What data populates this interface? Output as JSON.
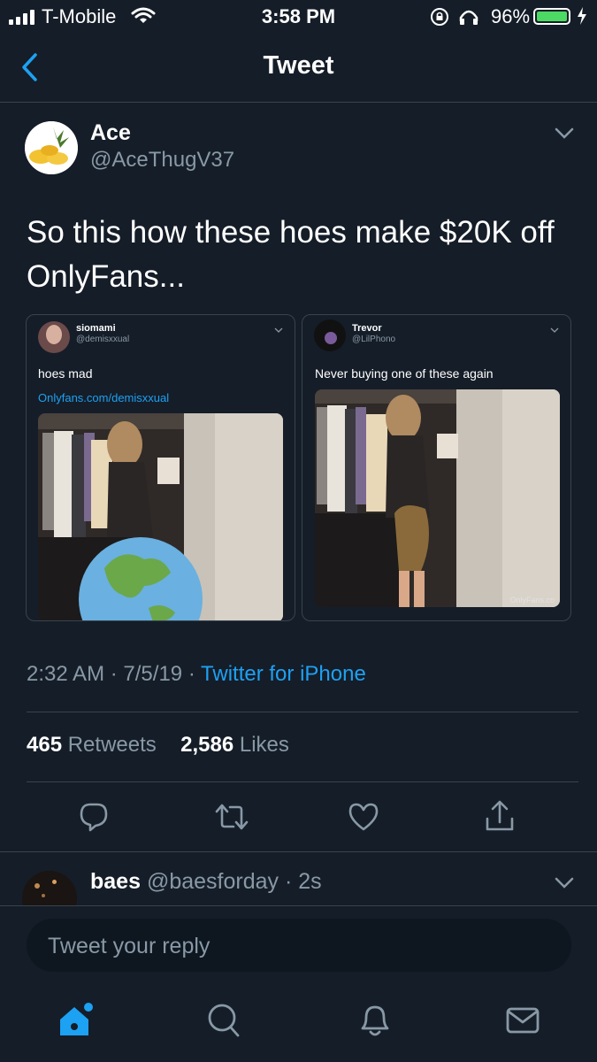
{
  "status_bar": {
    "carrier": "T-Mobile",
    "time": "3:58 PM",
    "battery": "96%",
    "battery_level": 0.96
  },
  "nav": {
    "title": "Tweet",
    "back_icon": "chevron-left-icon"
  },
  "tweet": {
    "author_name": "Ace",
    "author_handle": "@AceThugV37",
    "text": "So this how these hoes make $20K off OnlyFans...",
    "quoted": [
      {
        "name": "siomami",
        "handle": "@demisxxual",
        "text": "hoes mad",
        "link": "Onlyfans.com/demisxxual"
      },
      {
        "name": "Trevor",
        "handle": "@LilPhono",
        "text": "Never buying one of these again",
        "watermark": "OnlyFans.co"
      }
    ],
    "time": "2:32 AM",
    "date": "7/5/19",
    "source": "Twitter for iPhone",
    "retweets_count": "465",
    "retweets_label": "Retweets",
    "likes_count": "2,586",
    "likes_label": "Likes"
  },
  "reply_preview": {
    "name": "baes",
    "handle": "@baesforday",
    "time": "2s"
  },
  "composer": {
    "placeholder": "Tweet your reply"
  },
  "colors": {
    "background": "#151d28",
    "accent": "#1da1f2",
    "muted": "#8899a6",
    "divider": "#38444d"
  }
}
